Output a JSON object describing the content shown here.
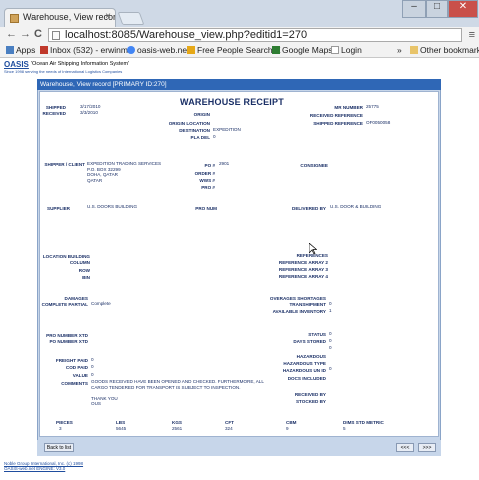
{
  "browser": {
    "tab_title": "Warehouse, View record [",
    "tab_close": "×",
    "url": "localhost:8085/Warehouse_view.php?editid1=270",
    "back_icon": "←",
    "forward_icon": "→",
    "reload_icon": "C",
    "menu_icon": "≡",
    "bookmarks": [
      {
        "label": "Apps",
        "icon": "apps-icon",
        "color": "#4a7fc1"
      },
      {
        "label": "Inbox (532) - erwinm",
        "icon": "gmail-icon",
        "color": "#c0392b"
      },
      {
        "label": "oasis-web.net",
        "icon": "google-icon",
        "color": "#4285f4"
      },
      {
        "label": "Free People Search E",
        "icon": "search-icon",
        "color": "#e6a817"
      },
      {
        "label": "Google Maps",
        "icon": "maps-icon",
        "color": "#2e7d32"
      },
      {
        "label": "Login",
        "icon": "page-icon",
        "color": "#999999"
      }
    ],
    "overflow": "»",
    "other_bookmarks": "Other bookmarks"
  },
  "app": {
    "logo": "OASIS",
    "tagline": "'Ocean Air Shipping Information System'",
    "subtagline": "Since 1998 serving the needs of International Logistics Companies",
    "panel_title": "Warehouse, View record [PRIMARY ID:270]",
    "heading": "WAREHOUSE RECEIPT"
  },
  "fields": {
    "shipped_label": "SHIPPED",
    "shipped_value": "3/17/2010",
    "received_label": "RECEIVED",
    "received_value": "3/3/2010",
    "origin_label": "ORIGIN",
    "origin_location_label": "ORIGIN LOCATION",
    "destination_label": "DESTINATION",
    "destination_value": "EXPEDITION",
    "pla_del_label": "PLA DEL",
    "pla_del_value": "0",
    "mr_number_label": "MR NUMBER",
    "mr_number_value": "25775",
    "received_reference_label": "RECEIVED REFERENCE",
    "shipped_reference_label": "SHIPPED REFERENCE",
    "shipped_reference_value": "OF0050058",
    "shipper_label": "SHIPPER / CLIENT",
    "shipper_value": "EXPEDITION TRADING SERVICES\nP.O. BOX 32299\nDOHA, QATAR\nQATAR",
    "po_label": "PO #",
    "po_value": "2901",
    "order_label": "ORDER #",
    "wws_label": "WWS #",
    "pro_label": "PRO #",
    "consignee_label": "CONSIGNEE",
    "supplier_label": "SUPPLIER",
    "supplier_value": "U.S. DOORS BUILDING",
    "pro_num_label": "PRO NUM",
    "delivered_by_label": "DELIVERED BY",
    "delivered_by_value": "U.S. DOOR & BUILDING",
    "location_building_label": "LOCATION BUILDING",
    "column_label": "COLUMN",
    "row_label": "ROW",
    "bin_label": "BIN",
    "references_label": "REFERENCES",
    "ref_array2_label": "REFERENCE ARRAY 2",
    "ref_array3_label": "REFERENCE ARRAY 3",
    "ref_array4_label": "REFERENCE ARRAY 4",
    "damages_label": "DAMAGES",
    "complete_partial_label": "COMPLETE PARTIAL",
    "complete_partial_value": "Complete",
    "overages_label": "OVERAGES SHORTAGES",
    "transhipment_label": "TRANSHIPMENT",
    "transhipment_value": "0",
    "available_inventory_label": "AVAILABLE INVENTORY",
    "available_inventory_value": "1",
    "pro_number_xtd_label": "PRO NUMBER XTD",
    "po_number_xtd_label": "PO NUMBER XTD",
    "status_label": "STATUS",
    "status_value": "0",
    "days_stored_label": "DAYS STORED",
    "days_stored_value": "0",
    "days_extra_value": "0",
    "freight_paid_label": "FREIGHT PAID",
    "freight_paid_value": "0",
    "cod_paid_label": "COD PAID",
    "cod_paid_value": "0",
    "value_label": "VALUE",
    "value_value": "0",
    "comments_label": "COMMENTS",
    "comments_value": "GOODS RECEIVED HAVE BEEN OPENED AND CHECKED. FURTHERMORE, ALL\nCARGO TENDERED FOR TRANSPORT IS SUBJECT TO INSPECTION.\n\nTHANK YOU\nOUS",
    "hazardous_label": "HAZARDOUS",
    "hazardous_type_label": "HAZARDOUS TYPE",
    "hazardous_un_label": "HAZARDOUS UN ID",
    "hazardous_un_value": "0",
    "docs_included_label": "DOCS INCLUDED",
    "received_by_label": "RECEIVED BY",
    "stocked_by_label": "STOCKED BY"
  },
  "totals": [
    {
      "label": "PIECES",
      "value": "3"
    },
    {
      "label": "LBS",
      "value": "5645"
    },
    {
      "label": "KGS",
      "value": "2561"
    },
    {
      "label": "CFT",
      "value": "324"
    },
    {
      "label": "CBM",
      "value": "9"
    },
    {
      "label": "DIMS STD METRIC",
      "value": "5"
    }
  ],
  "buttons": {
    "back_to_list": "Back to list",
    "prev": "<<<",
    "next": ">>>"
  },
  "footer": {
    "line1": "Noble Group International, Inc. (c) 1998",
    "line2": "OASIS-web.net ENGINE: V3.0"
  }
}
